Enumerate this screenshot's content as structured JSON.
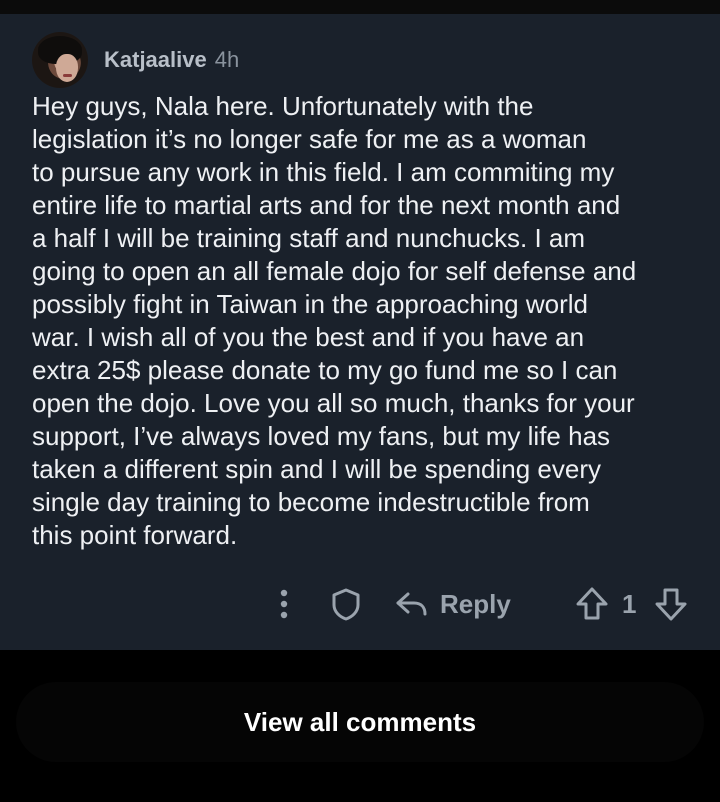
{
  "comment": {
    "username": "Katjaalive",
    "time_ago": "4h",
    "body": "Hey guys, Nala here. Unfortunately with the\nlegislation it’s no longer safe for me as a woman\nto pursue any work in this field. I am commiting my\nentire life to martial arts and for the next month and\na half I will be training staff and nunchucks. I am\ngoing to open an all female dojo for self defense and\npossibly fight in Taiwan in the approaching world\nwar. I wish all of you the best and if you have an\nextra 25$ please donate to my go fund me so I can\nopen the dojo. Love you all so much, thanks for your\nsupport, I’ve always loved my fans, but my life has\ntaken a different spin and I will be spending every\nsingle day training to become indestructible from\nthis point forward."
  },
  "actions": {
    "more_icon": "more-vertical-icon",
    "award_icon": "award-shield-icon",
    "reply_icon": "reply-arrow-icon",
    "reply_label": "Reply",
    "upvote_icon": "upvote-arrow-icon",
    "score": "1",
    "downvote_icon": "downvote-arrow-icon"
  },
  "footer": {
    "view_all_label": "View all comments"
  },
  "colors": {
    "page_background": "#000000",
    "card_background": "#1a212b",
    "body_text": "#eef0f3",
    "muted_text": "#9aa3ad"
  }
}
